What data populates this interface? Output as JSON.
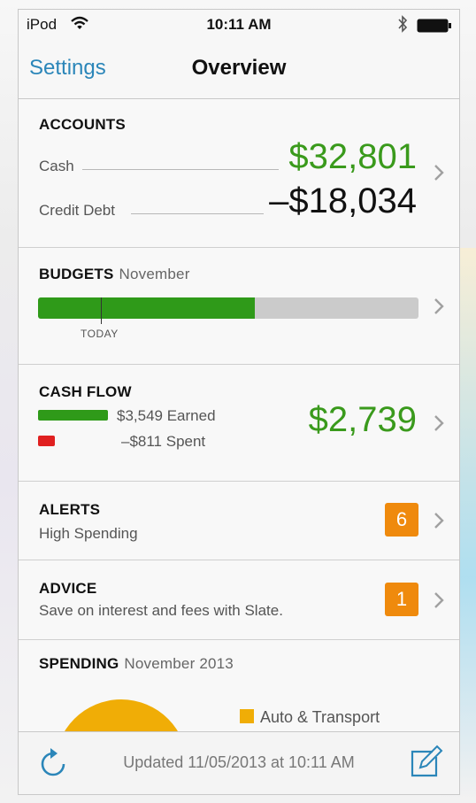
{
  "status": {
    "carrier": "iPod",
    "time": "10:11 AM"
  },
  "nav": {
    "back_label": "Settings",
    "title": "Overview"
  },
  "accounts": {
    "title": "ACCOUNTS",
    "rows": [
      {
        "label": "Cash",
        "value": "$32,801",
        "color": "#3a9a1c"
      },
      {
        "label": "Credit Debt",
        "value": "–$18,034",
        "color": "#111111"
      }
    ]
  },
  "budgets": {
    "title": "BUDGETS",
    "subtitle": "November",
    "progress": 0.57,
    "today_label": "TODAY",
    "fill_color": "#2f9a19"
  },
  "cash_flow": {
    "title": "CASH FLOW",
    "earned": "$3,549 Earned",
    "spent": "–$811 Spent",
    "total": "$2,739",
    "earned_color": "#2f9a19",
    "spent_color": "#e02020"
  },
  "alerts": {
    "title": "ALERTS",
    "subtitle": "High Spending",
    "count": "6"
  },
  "advice": {
    "title": "ADVICE",
    "subtitle": "Save on interest and fees with Slate.",
    "count": "1"
  },
  "spending": {
    "title": "SPENDING",
    "subtitle": "November 2013",
    "legend": [
      {
        "label": "Auto & Transport",
        "color": "#f0ad06"
      }
    ]
  },
  "toolbar": {
    "updated": "Updated 11/05/2013 at 10:11 AM"
  },
  "icons": [
    "wifi-icon",
    "bluetooth-icon",
    "battery-icon",
    "chevron-right-icon",
    "refresh-icon",
    "compose-icon"
  ]
}
